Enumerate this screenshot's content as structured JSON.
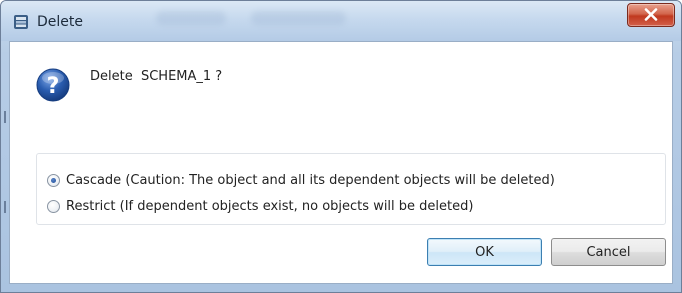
{
  "window": {
    "title": "Delete",
    "close_icon": "close-icon",
    "app_icon": "database-icon"
  },
  "dialog": {
    "prompt": "Delete  SCHEMA_1 ?",
    "question_icon": "question-icon",
    "options": [
      {
        "label": "Cascade (Caution: The object and all its dependent objects will be deleted)",
        "selected": true
      },
      {
        "label": "Restrict (If dependent objects exist, no objects will be deleted)",
        "selected": false
      }
    ],
    "ok_label": "OK",
    "cancel_label": "Cancel"
  },
  "colors": {
    "close_button": "#c0391f",
    "default_button_border": "#3c7fb1",
    "question_icon": "#2a5db0"
  }
}
